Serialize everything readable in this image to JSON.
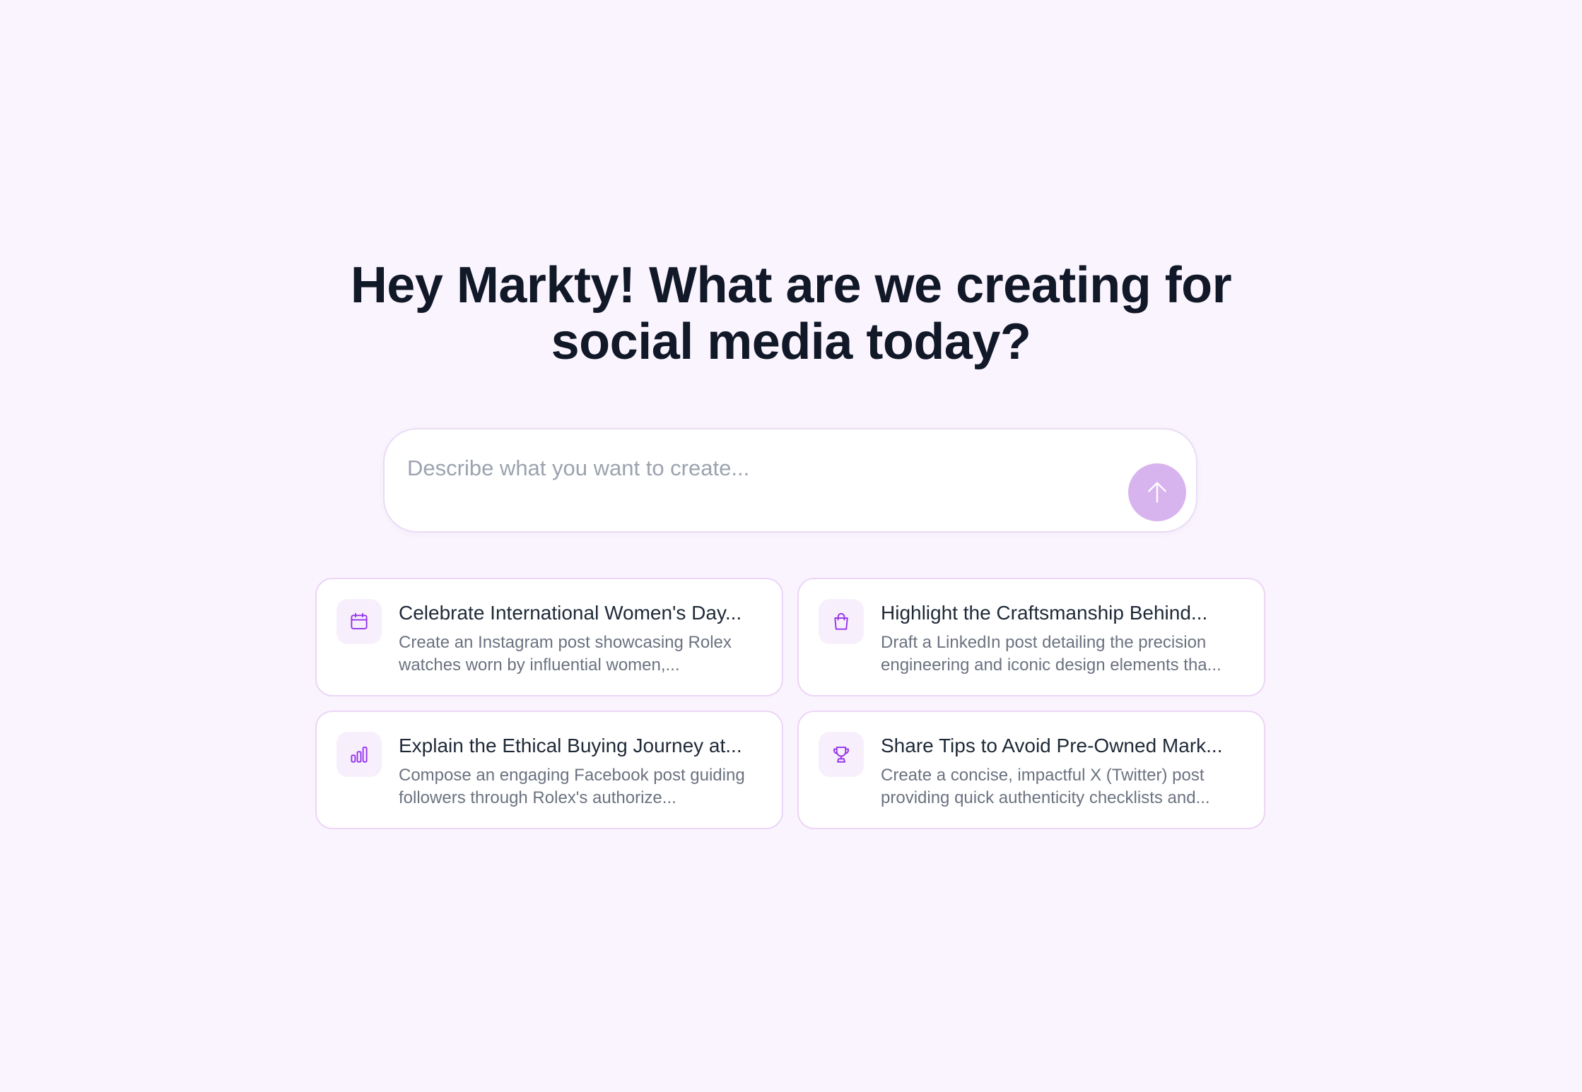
{
  "headline": {
    "line1": "Hey Markty! What are we creating for",
    "line2": "social media today?"
  },
  "prompt": {
    "placeholder": "Describe what you want to create...",
    "value": "",
    "send_icon": "arrow-up-icon"
  },
  "colors": {
    "background": "#faf4fe",
    "accent": "#9333ea",
    "send_button": "#d8b4ef",
    "card_border": "#ecd6f6"
  },
  "suggestions": [
    {
      "icon": "calendar-icon",
      "title": "Celebrate International Women's Day...",
      "description": "Create an Instagram post showcasing Rolex watches worn by influential women,..."
    },
    {
      "icon": "shopping-bag-icon",
      "title": "Highlight the Craftsmanship Behind...",
      "description": "Draft a LinkedIn post detailing the precision engineering and iconic design elements tha..."
    },
    {
      "icon": "bar-chart-icon",
      "title": "Explain the Ethical Buying Journey at...",
      "description": "Compose an engaging Facebook post guiding followers through Rolex's authorize..."
    },
    {
      "icon": "trophy-icon",
      "title": "Share Tips to Avoid Pre-Owned Mark...",
      "description": "Create a concise, impactful X (Twitter) post providing quick authenticity checklists and..."
    }
  ]
}
